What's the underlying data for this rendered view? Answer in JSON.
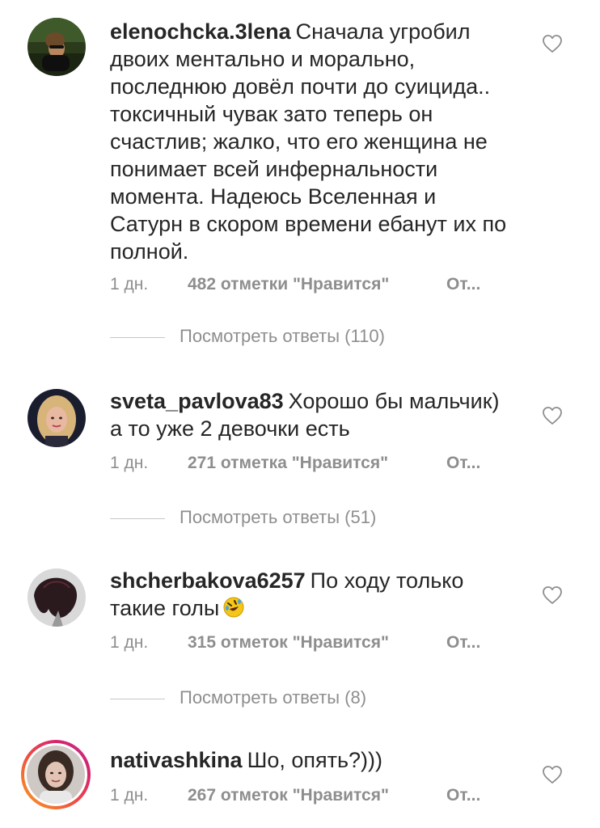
{
  "comments": [
    {
      "username": "elenochcka.3lena",
      "text": "Сначала угробил двоих ментально и морально, последнюю довёл почти до суицида.. токсичный чувак  зато теперь он счастлив;  жалко, что его женщина не понимает всей инфернальности момента. Надеюсь Вселенная и Сатурн в скором времени ебанут их по полной.",
      "time": "1 дн.",
      "likes": "482 отметки \"Нравится\"",
      "reply": "От...",
      "view_replies": "Посмотреть ответы (110)",
      "avatar_icon": "avatar-photo-woman-car"
    },
    {
      "username": "sveta_pavlova83",
      "text": "Хорошо бы мальчик) а то уже 2 девочки есть",
      "time": "1 дн.",
      "likes": "271 отметка \"Нравится\"",
      "reply": "От...",
      "view_replies": "Посмотреть ответы (51)",
      "avatar_icon": "avatar-photo-blonde-woman"
    },
    {
      "username": "shcherbakova6257",
      "text": "По ходу только такие голы",
      "emoji": "rolling-on-floor-laughing-emoji",
      "time": "1 дн.",
      "likes": "315 отметок \"Нравится\"",
      "reply": "От...",
      "view_replies": "Посмотреть ответы (8)",
      "avatar_icon": "avatar-photo-dark-hair"
    },
    {
      "username": "nativashkina",
      "text": "Шо, опять?)))",
      "time": "1 дн.",
      "likes": "267 отметок \"Нравится\"",
      "reply": "От...",
      "avatar_icon": "avatar-photo-with-story-ring"
    }
  ],
  "colors": {
    "text": "#262626",
    "secondary": "#8e8e8e",
    "divider": "#c7c7c7",
    "story_ring_start": "#f9a01b",
    "story_ring_end": "#c22f8d"
  },
  "icons": {
    "like": "heart-outline-icon"
  }
}
